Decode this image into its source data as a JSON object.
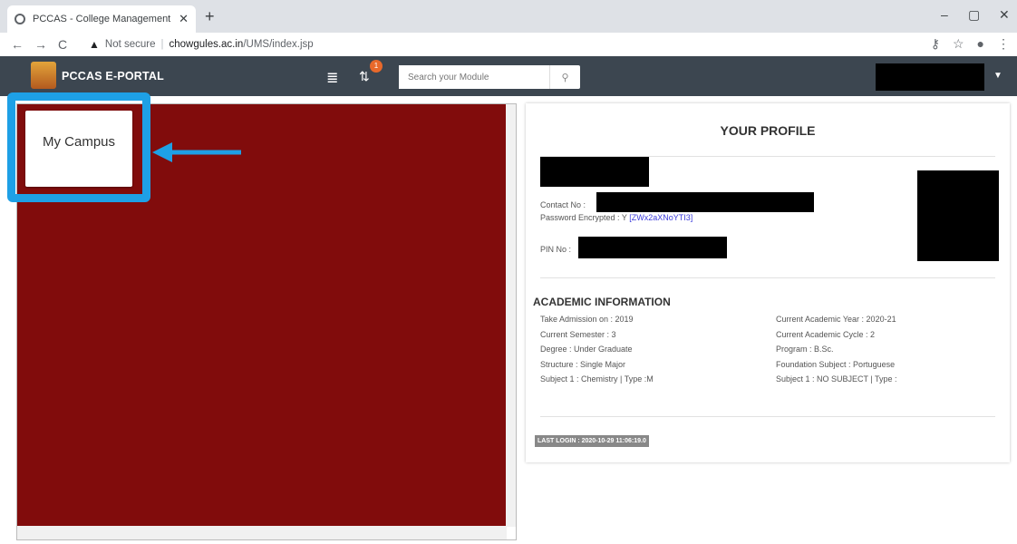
{
  "browser": {
    "tab_title": "PCCAS - College Management S",
    "tab_close": "✕",
    "new_tab": "+",
    "not_secure": "Not secure",
    "url_host": "chowgules.ac.in",
    "url_path": "/UMS/index.jsp",
    "back": "←",
    "forward": "→",
    "reload": "C",
    "minimize": "–",
    "maximize": "▢",
    "close": "✕"
  },
  "header": {
    "brand": "PCCAS E-PORTAL",
    "notif_count": "1",
    "search_placeholder": "Search your Module"
  },
  "left": {
    "tile_label": "My Campus"
  },
  "profile": {
    "title": "YOUR PROFILE",
    "contact_label": "Contact No :",
    "password_label": "Password Encrypted : Y",
    "password_value": "[ZWx2aXNoYTI3]",
    "pin_label": "PIN No :",
    "academic_title": "ACADEMIC INFORMATION",
    "academic_left": [
      "Take Admission on : 2019",
      "Current Semester : 3",
      "Degree : Under Graduate",
      "Structure : Single Major",
      "Subject 1 : Chemistry | Type :M"
    ],
    "academic_right": [
      "Current Academic Year : 2020-21",
      "Current Academic Cycle : 2",
      "Program : B.Sc.",
      "Foundation Subject : Portuguese",
      "Subject 1 : NO SUBJECT | Type :"
    ],
    "last_login": "LAST LOGIN : 2020-10-29 11:06:19.0"
  },
  "colors": {
    "header_bg": "#3c4650",
    "panel_red": "#810c0c",
    "highlight_blue": "#1ea0e6"
  }
}
